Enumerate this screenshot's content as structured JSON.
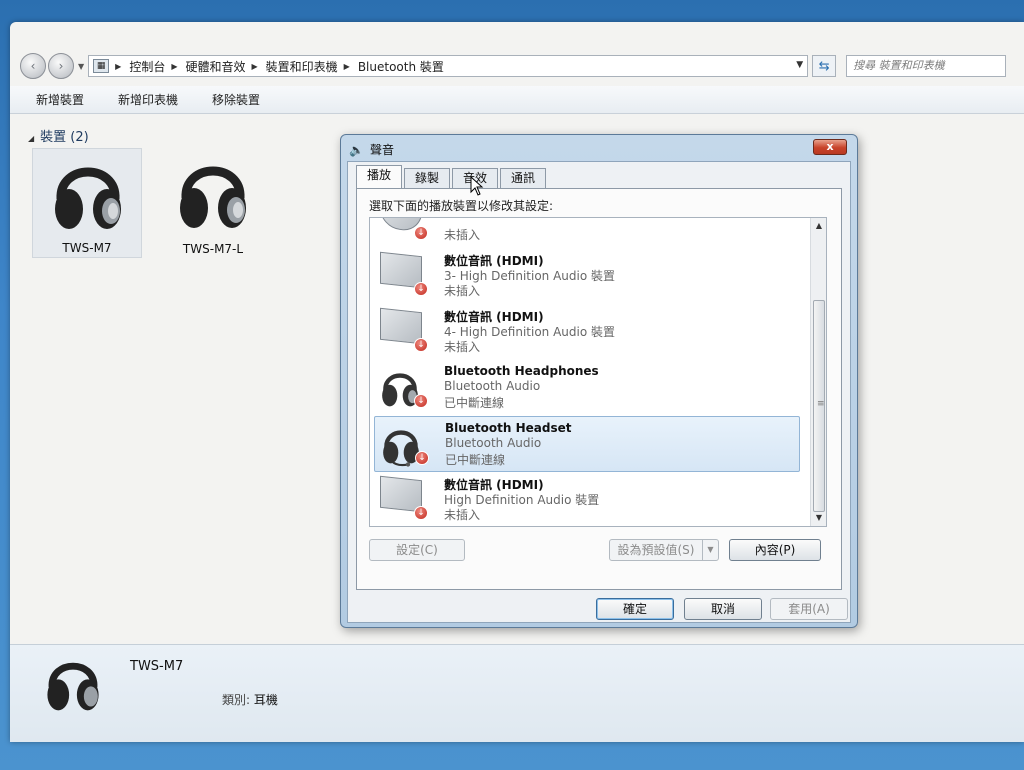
{
  "address": {
    "crumbs": [
      "控制台",
      "硬體和音效",
      "裝置和印表機",
      "Bluetooth 裝置"
    ],
    "search_placeholder": "搜尋 裝置和印表機"
  },
  "commands": [
    "新增裝置",
    "新增印表機",
    "移除裝置"
  ],
  "devices_section": {
    "title": "裝置 (2)"
  },
  "devices": [
    {
      "name": "TWS-M7"
    },
    {
      "name": "TWS-M7-L"
    }
  ],
  "details": {
    "name": "TWS-M7",
    "category_label": "類別:",
    "category_value": "耳機"
  },
  "sound_dialog": {
    "title": "聲音",
    "close_label": "x",
    "tabs": [
      "播放",
      "錄製",
      "音效",
      "通訊"
    ],
    "instruction": "選取下面的播放裝置以修改其設定:",
    "devices": [
      {
        "name": "",
        "desc": "",
        "status": "未插入",
        "icon": "speaker-icon"
      },
      {
        "name": "數位音訊 (HDMI)",
        "desc": "3- High Definition Audio 裝置",
        "status": "未插入",
        "icon": "monitor-icon"
      },
      {
        "name": "數位音訊 (HDMI)",
        "desc": "4- High Definition Audio 裝置",
        "status": "未插入",
        "icon": "monitor-icon"
      },
      {
        "name": "Bluetooth Headphones",
        "desc": "Bluetooth Audio",
        "status": "已中斷連線",
        "icon": "headphones-icon"
      },
      {
        "name": "Bluetooth Headset",
        "desc": "Bluetooth Audio",
        "status": "已中斷連線",
        "icon": "headset-icon"
      },
      {
        "name": "數位音訊 (HDMI)",
        "desc": "High Definition Audio 裝置",
        "status": "未插入",
        "icon": "monitor-icon"
      }
    ],
    "buttons": {
      "configure": "設定(C)",
      "set_default": "設為預設值(S)",
      "properties": "內容(P)",
      "ok": "確定",
      "cancel": "取消",
      "apply": "套用(A)"
    }
  },
  "colors": {
    "desktop": "#3f86c9",
    "window_bg": "#f3f3f1",
    "dialog_frame": "#b2cbe2",
    "close_red": "#c8432a",
    "selection": "#d6e6f5"
  }
}
